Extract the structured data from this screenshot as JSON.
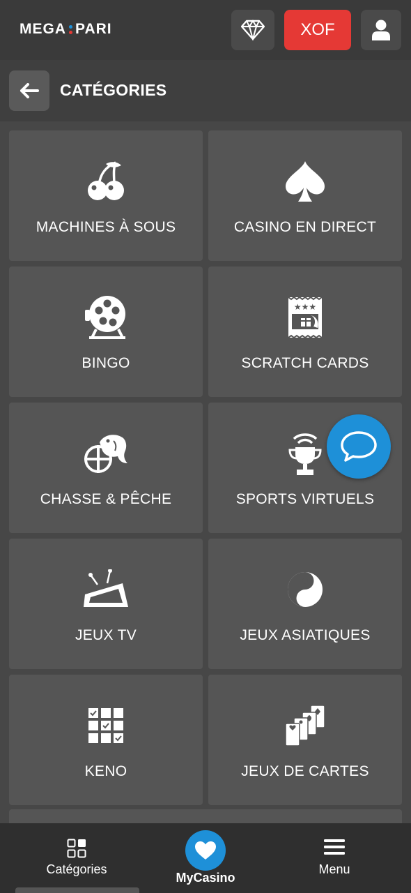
{
  "header": {
    "logo_left": "MEGA",
    "logo_right": "PARI",
    "currency": "XOF",
    "colors": {
      "currency_bg": "#e53935",
      "logo_dot_top": "#1e90d8",
      "logo_dot_bottom": "#e53935"
    }
  },
  "titlebar": {
    "title": "CATÉGORIES"
  },
  "categories": [
    {
      "label": "MACHINES À SOUS",
      "icon": "cherries-icon"
    },
    {
      "label": "CASINO EN DIRECT",
      "icon": "spade-icon"
    },
    {
      "label": "BINGO",
      "icon": "lottery-drum-icon"
    },
    {
      "label": "SCRATCH CARDS",
      "icon": "scratch-card-icon"
    },
    {
      "label": "CHASSE & PÊCHE",
      "icon": "target-fish-icon"
    },
    {
      "label": "SPORTS VIRTUELS",
      "icon": "trophy-signal-icon"
    },
    {
      "label": "JEUX TV",
      "icon": "tv-icon"
    },
    {
      "label": "JEUX ASIATIQUES",
      "icon": "yin-yang-icon"
    },
    {
      "label": "KENO",
      "icon": "keno-grid-icon"
    },
    {
      "label": "JEUX DE CARTES",
      "icon": "playing-cards-icon"
    }
  ],
  "bottom_nav": {
    "categories_label": "Catégories",
    "mycasino_label": "MyCasino",
    "menu_label": "Menu"
  },
  "accent_color": "#1e90d8"
}
